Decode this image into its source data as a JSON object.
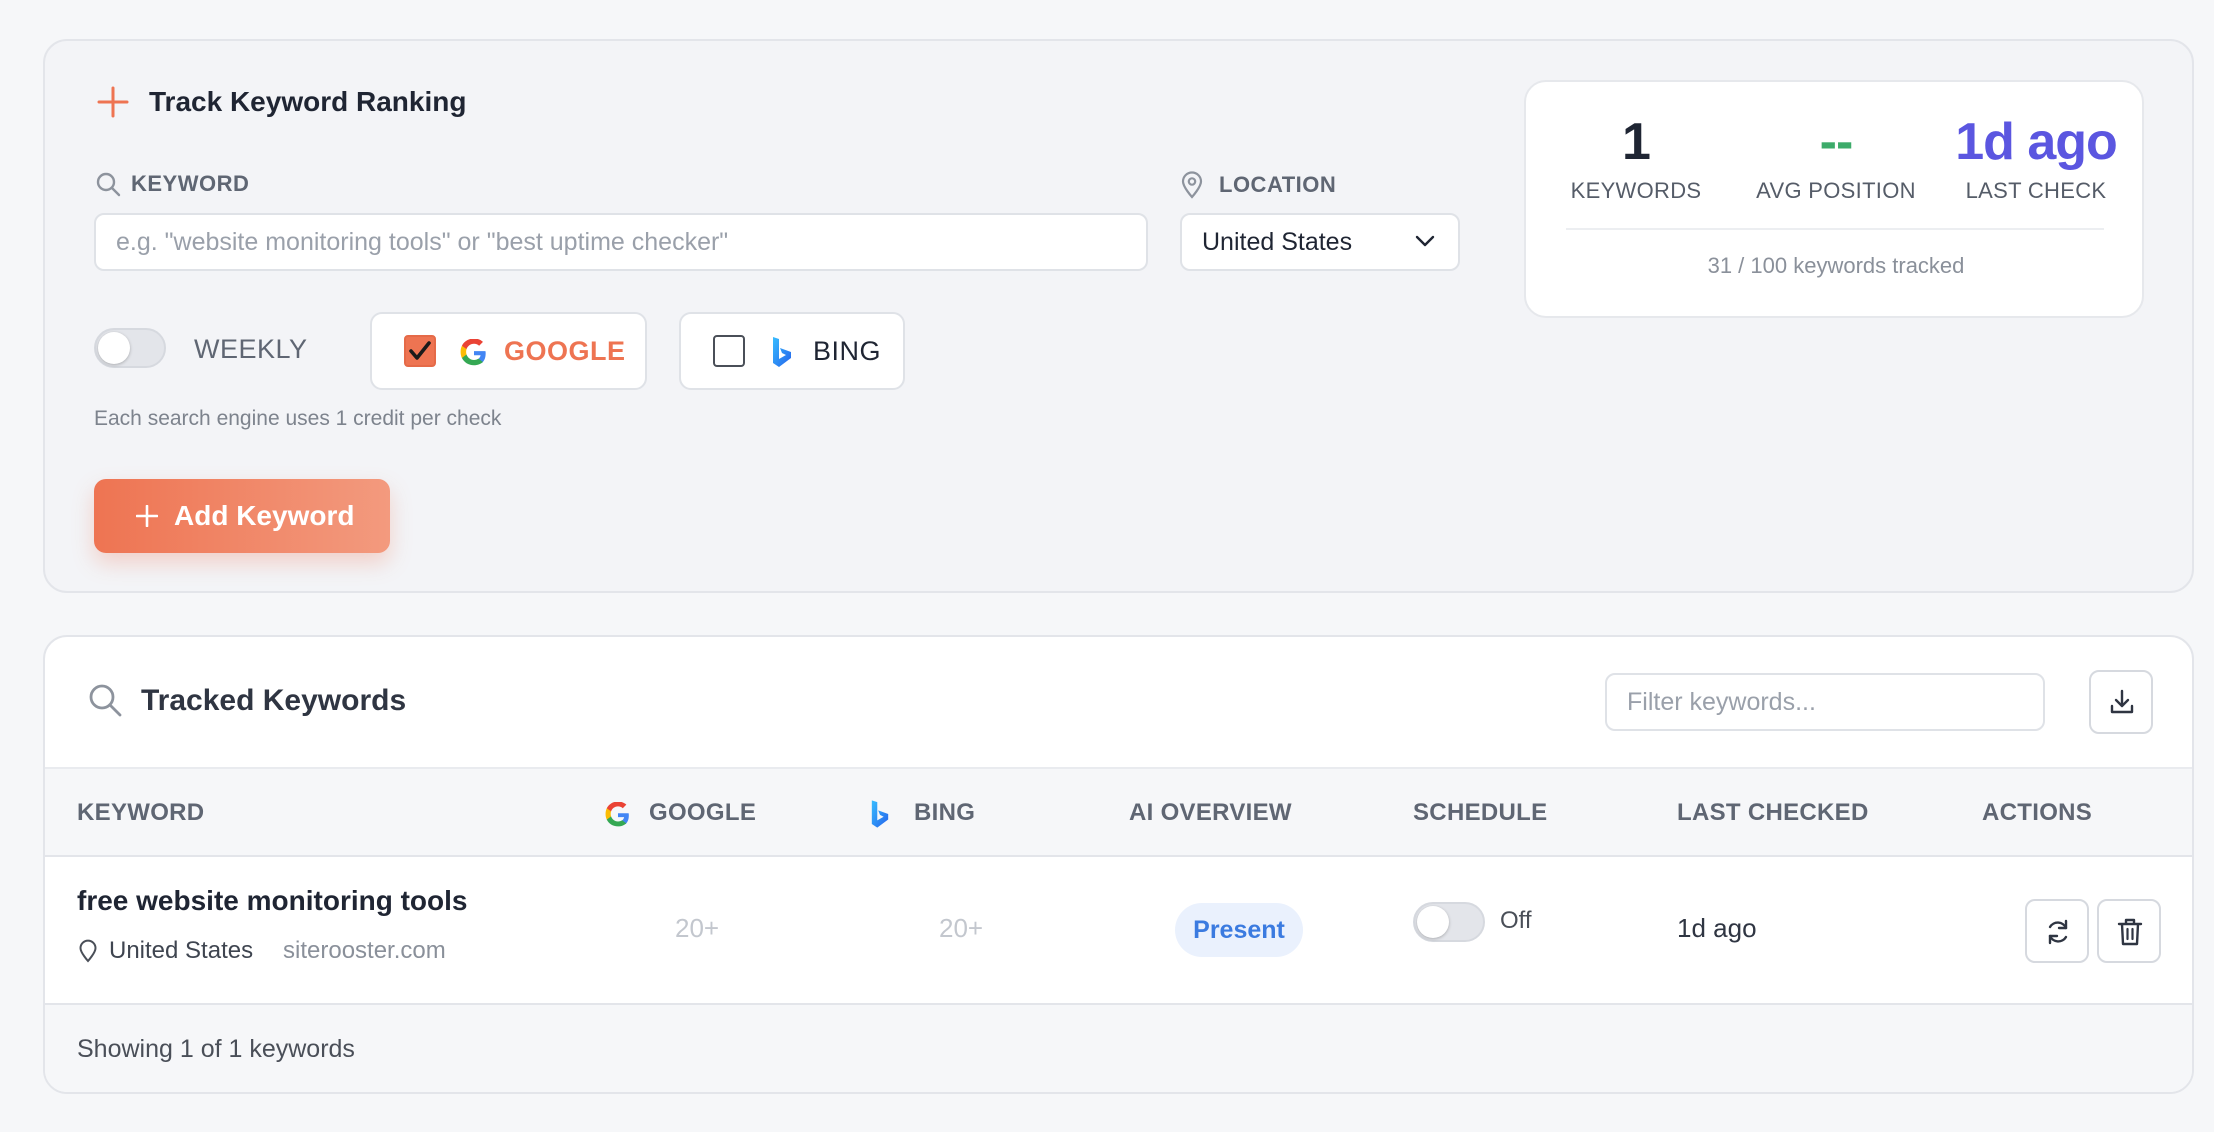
{
  "track": {
    "title": "Track Keyword Ranking",
    "keyword_label": "KEYWORD",
    "keyword_placeholder": "e.g. \"website monitoring tools\" or \"best uptime checker\"",
    "location_label": "LOCATION",
    "location_value": "United States",
    "weekly_label": "WEEKLY",
    "weekly_on": false,
    "google_label": "GOOGLE",
    "google_checked": true,
    "bing_label": "BING",
    "bing_checked": false,
    "credit_note": "Each search engine uses 1 credit per check",
    "add_button": "Add Keyword",
    "accent_color": "#ee7452"
  },
  "stats": {
    "keywords_value": "1",
    "keywords_label": "KEYWORDS",
    "avg_value": "--",
    "avg_label": "AVG POSITION",
    "last_value": "1d ago",
    "last_label": "LAST CHECK",
    "tracked": "31 / 100 keywords tracked",
    "avg_color": "#3dab6a",
    "last_color": "#5b56e0"
  },
  "table": {
    "title": "Tracked Keywords",
    "filter_placeholder": "Filter keywords...",
    "columns": [
      "KEYWORD",
      "GOOGLE",
      "BING",
      "AI OVERVIEW",
      "SCHEDULE",
      "LAST CHECKED",
      "ACTIONS"
    ],
    "rows": [
      {
        "keyword": "free website monitoring tools",
        "location": "United States",
        "domain": "siterooster.com",
        "google": "20+",
        "bing": "20+",
        "ai_overview": "Present",
        "schedule": "Off",
        "last_checked": "1d ago"
      }
    ],
    "footer": "Showing 1 of 1 keywords"
  },
  "icons": [
    "plus-icon",
    "search-icon",
    "location-pin-icon",
    "chevron-down-icon",
    "google-icon",
    "bing-icon",
    "download-icon",
    "refresh-icon",
    "trash-icon"
  ]
}
